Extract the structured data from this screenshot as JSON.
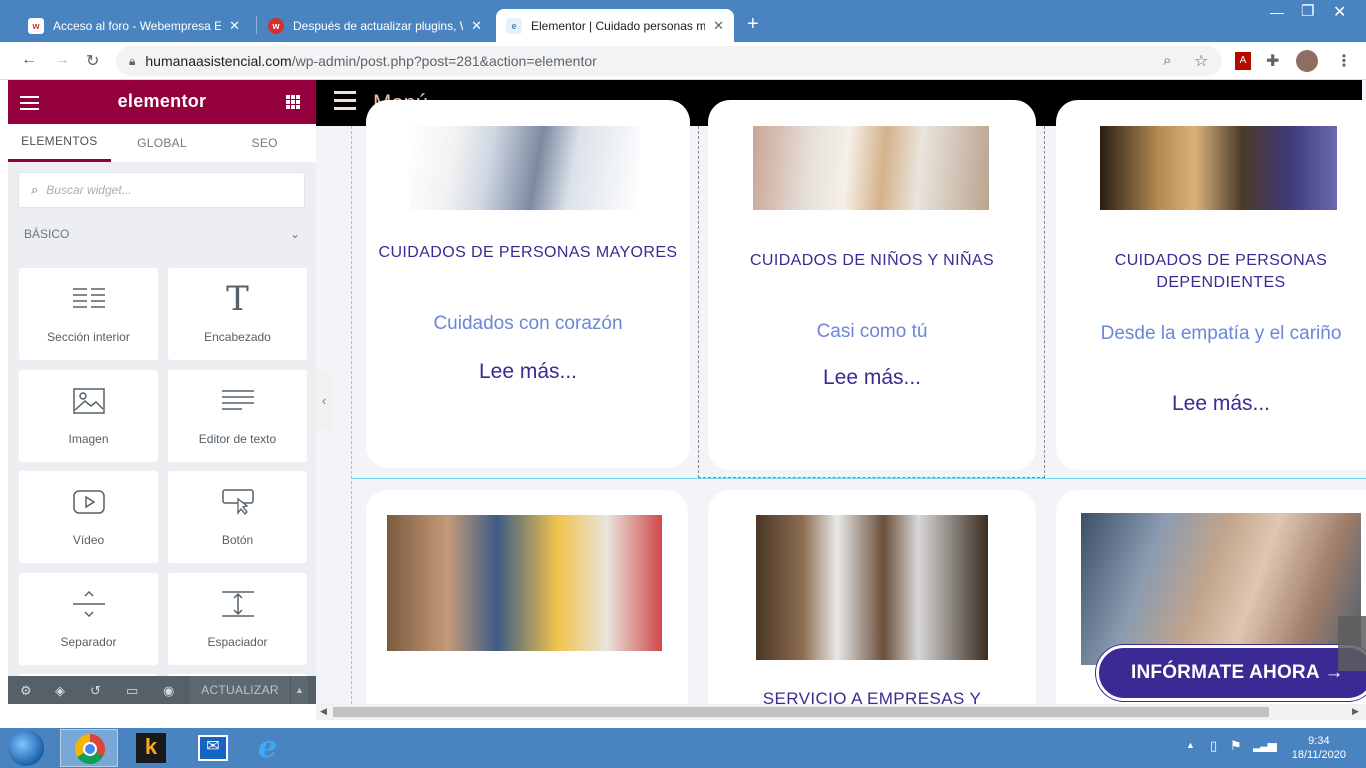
{
  "browser": {
    "tabs": [
      {
        "title": "Acceso al foro - Webempresa Eu",
        "favicon_letter": "w"
      },
      {
        "title": "Después de actualizar plugins, W",
        "favicon_letter": "w"
      },
      {
        "title": "Elementor | Cuidado personas m",
        "favicon_letter": "e"
      }
    ],
    "url_domain": "humanaasistencial.com",
    "url_path": "/wp-admin/post.php?post=281&action=elementor"
  },
  "elementor": {
    "logo": "elementor",
    "tabs": [
      "ELEMENTOS",
      "GLOBAL",
      "SEO"
    ],
    "search_placeholder": "Buscar widget...",
    "category": "BÁSICO",
    "widgets": [
      {
        "label": "Sección interior",
        "icon": "inner-section-icon"
      },
      {
        "label": "Encabezado",
        "icon": "heading-icon"
      },
      {
        "label": "Imagen",
        "icon": "image-icon"
      },
      {
        "label": "Editor de texto",
        "icon": "text-editor-icon"
      },
      {
        "label": "Vídeo",
        "icon": "video-icon"
      },
      {
        "label": "Botón",
        "icon": "button-icon"
      },
      {
        "label": "Separador",
        "icon": "divider-icon"
      },
      {
        "label": "Espaciador",
        "icon": "spacer-icon"
      }
    ],
    "update_label": "ACTUALIZAR"
  },
  "page": {
    "menu_label": "Menú",
    "cards_top": [
      {
        "title": "CUIDADOS DE PERSONAS MAYORES",
        "subtitle": "Cuidados con corazón",
        "more": "Lee más..."
      },
      {
        "title": "CUIDADOS DE NIÑOS Y NIÑAS",
        "subtitle": "Casi como tú",
        "more": "Lee más..."
      },
      {
        "title": "CUIDADOS DE PERSONAS DEPENDIENTES",
        "subtitle": "Desde la empatía y el cariño",
        "more": "Lee más..."
      }
    ],
    "cards_bottom_title_partial": "SERVICIO A EMPRESAS Y",
    "cta": "INFÓRMATE AHORA →"
  },
  "taskbar": {
    "time": "9:34",
    "date": "18/11/2020"
  },
  "colors": {
    "elementor_brand": "#93003c",
    "title_purple": "#3b2a93",
    "subtitle_blue": "#6c86d8",
    "menu_peach": "#eabfa8"
  }
}
